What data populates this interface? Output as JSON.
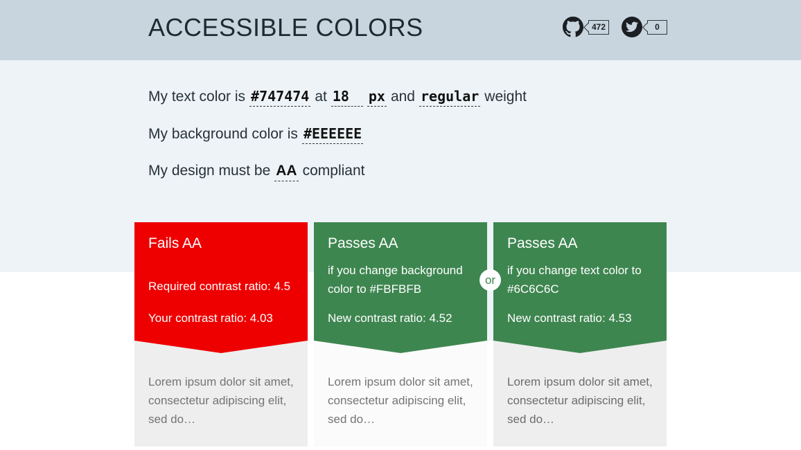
{
  "header": {
    "title": "ACCESSIBLE COLORS",
    "github": {
      "icon": "github-icon",
      "count": "472"
    },
    "twitter": {
      "icon": "twitter-icon",
      "count": "0"
    }
  },
  "config": {
    "text_color": {
      "prefix": "My text color is",
      "value": "#747474",
      "at": "at",
      "size": "18",
      "unit": "px",
      "and": "and",
      "weight": "regular",
      "suffix": "weight"
    },
    "background": {
      "prefix": "My background color is",
      "value": "#EEEEEE"
    },
    "compliance": {
      "prefix": "My design must be",
      "level": "AA",
      "suffix": "compliant"
    }
  },
  "colors": {
    "header_bg": "#c8d5de",
    "config_bg": "#eef3f7",
    "fail": "#ee0000",
    "pass": "#3e8650",
    "text_color": "#747474",
    "background": "#EEEEEE",
    "suggested_background": "#FBFBFB",
    "suggested_text": "#6C6C6C"
  },
  "cards": [
    {
      "status": "Fails AA",
      "line1": "Required contrast ratio: 4.5",
      "line2": "Your contrast ratio: 4.03",
      "lorem": "Lorem ipsum dolor sit amet, consectetur adipiscing elit, sed do…"
    },
    {
      "status": "Passes AA",
      "subtitle": "if you change background color to #FBFBFB",
      "line2": "New contrast ratio: 4.52",
      "lorem": "Lorem ipsum dolor sit amet, consectetur adipiscing elit, sed do…"
    },
    {
      "status": "Passes AA",
      "subtitle": "if you change text color to #6C6C6C",
      "line2": "New contrast ratio: 4.53",
      "lorem": "Lorem ipsum dolor sit amet, consectetur adipiscing elit, sed do…"
    }
  ],
  "or_label": "or"
}
